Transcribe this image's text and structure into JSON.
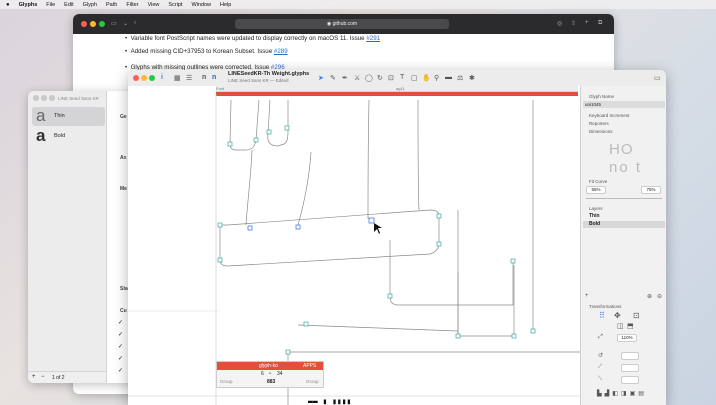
{
  "menubar": {
    "apple": "",
    "items": [
      "Glyphs",
      "File",
      "Edit",
      "Glyph",
      "Path",
      "Filter",
      "View",
      "Script",
      "Window",
      "Help"
    ]
  },
  "browser": {
    "url": "github.com",
    "bullets": [
      {
        "text": "Variable font PostScript names were updated to display correctly on macOS 11. Issue ",
        "link": "#291"
      },
      {
        "text": "Added missing CID+37953 to Korean Subset. Issue ",
        "link": "#289"
      },
      {
        "text": "Glyphs with missing outlines were corrected. Issue ",
        "link": "#296"
      }
    ]
  },
  "fontinfo": {
    "subtitle": "LINE Seed Sans KR",
    "masters": [
      {
        "name": "Thin",
        "glyph": "a"
      },
      {
        "name": "Bold",
        "glyph": "a"
      }
    ],
    "section_labels": [
      "Ge",
      "Ax",
      "Me",
      "Sta",
      "Cu"
    ],
    "pager": "1 of 2",
    "add": "+",
    "remove": "−"
  },
  "glyphs": {
    "title": "LINESeedKR-Th Weight.glyphs",
    "subtitle": "LINE Seed Sans KR — Edited",
    "tab_left": "Font",
    "tab_right": "ag11",
    "panel": {
      "glyph_name_label": "Glyph Name",
      "glyph_name": "uni1045",
      "sections": [
        "Keyboard Increment",
        "Reporters",
        "Dimensions"
      ],
      "preview_top": "HO",
      "preview_bottom": "no t",
      "fit_curve_label": "Fit Curve",
      "fit_left": "56%",
      "fit_right": "75%",
      "layers_label": "Layers",
      "layers": [
        "Thin",
        "Bold"
      ],
      "transformations_label": "Transformations",
      "scale_value": "110%"
    },
    "infobox": {
      "title": "glyph-ko",
      "status": "APPS",
      "width_label": "Width",
      "width_value": "883",
      "lsb": "6",
      "rsb": "34",
      "left_label": "Group",
      "right_label": "Group"
    }
  },
  "colors": {
    "accent_red": "#e0503b",
    "node_teal": "#3aa6a0",
    "selection_blue": "#3d7cf0"
  }
}
